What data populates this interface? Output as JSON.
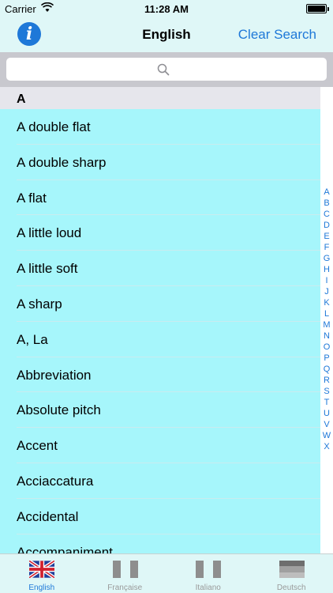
{
  "status": {
    "carrier": "Carrier",
    "time": "11:28 AM"
  },
  "nav": {
    "info_icon": "i",
    "title": "English",
    "clear_label": "Clear Search"
  },
  "search": {
    "placeholder": ""
  },
  "section": {
    "header": "A"
  },
  "list": {
    "items": [
      "A double flat",
      "A double sharp",
      "A flat",
      "A little loud",
      "A little soft",
      "A sharp",
      "A, La",
      "Abbreviation",
      "Absolute pitch",
      "Accent",
      "Acciaccatura",
      "Accidental",
      "Accompaniment"
    ]
  },
  "index": [
    "A",
    "B",
    "C",
    "D",
    "E",
    "F",
    "G",
    "H",
    "I",
    "J",
    "K",
    "L",
    "M",
    "N",
    "O",
    "P",
    "Q",
    "R",
    "S",
    "T",
    "U",
    "V",
    "W",
    "X"
  ],
  "tabs": [
    {
      "label": "English",
      "icon": "uk-flag-icon",
      "active": true
    },
    {
      "label": "Française",
      "icon": "french-flag-icon",
      "active": false
    },
    {
      "label": "Italiano",
      "icon": "italian-flag-icon",
      "active": false
    },
    {
      "label": "Deutsch",
      "icon": "german-flag-icon",
      "active": false
    }
  ],
  "colors": {
    "accent": "#1e78d8",
    "list_background": "#a6f6fb",
    "bar_background": "#dff7f7",
    "inactive_tab": "#9a9a9a"
  }
}
